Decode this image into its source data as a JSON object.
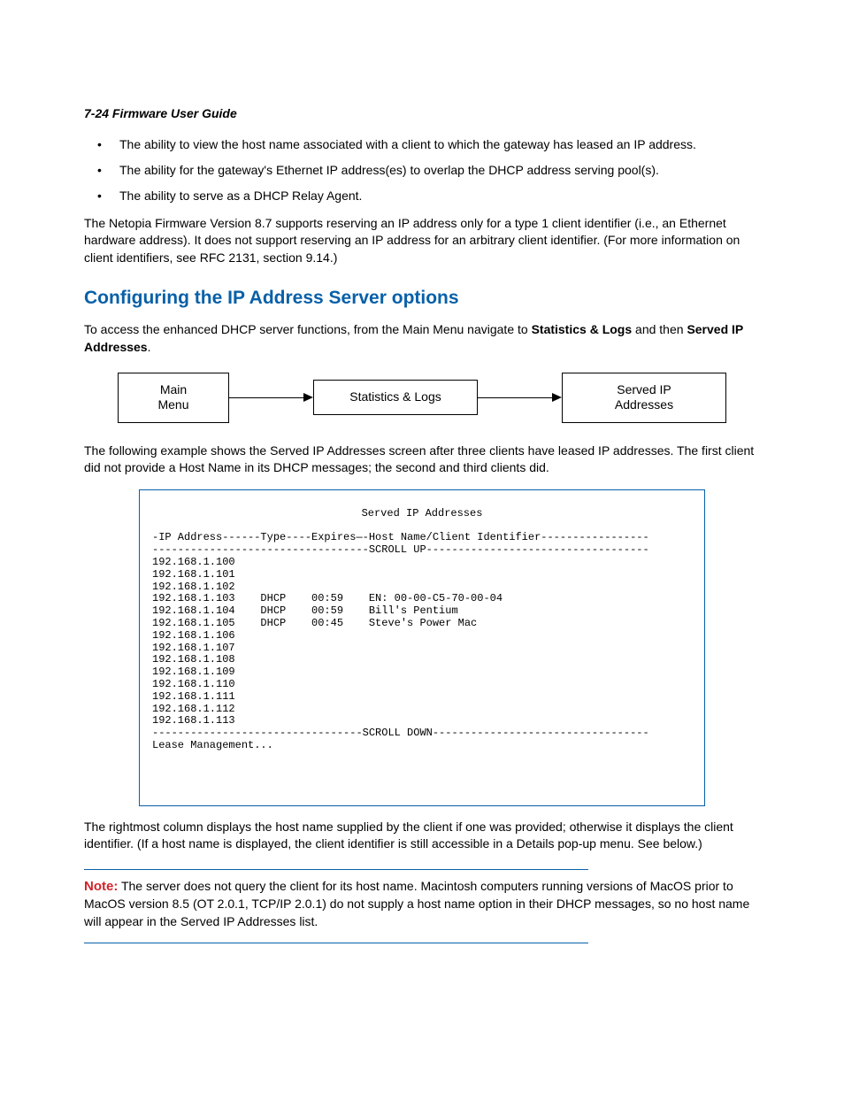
{
  "header": "7-24  Firmware User Guide",
  "bullets": [
    "The ability to view the host name associated with a client to which the gateway has leased an IP address.",
    "The ability for the gateway's Ethernet IP address(es) to overlap the DHCP address serving pool(s).",
    "The ability to serve as a DHCP Relay Agent."
  ],
  "para1": "The Netopia Firmware Version 8.7 supports reserving an IP address only for a type 1 client identifier (i.e., an Ethernet hardware address). It does not support reserving an IP address for an arbitrary client identifier. (For more information on client identifiers, see RFC 2131, section 9.14.)",
  "section_title": "Configuring the IP Address Server options",
  "para2_a": "To access the enhanced DHCP server functions, from the Main Menu navigate to ",
  "para2_b": "Statistics & Logs",
  "para2_c": " and then ",
  "para2_d": "Served IP Addresses",
  "para2_e": ".",
  "nav": {
    "box1_l1": "Main",
    "box1_l2": "Menu",
    "box2": "Statistics & Logs",
    "box3_l1": "Served IP",
    "box3_l2": "Addresses"
  },
  "para3": "The following example shows the Served IP Addresses screen after three clients have leased IP addresses. The first client did not provide a Host Name in its DHCP messages; the second and third clients did.",
  "terminal": {
    "title": "Served IP Addresses",
    "header_row": "-IP Address------Type----Expires—-Host Name/Client Identifier-----------------",
    "scroll_up": "----------------------------------SCROLL UP-----------------------------------",
    "rows": [
      "192.168.1.100",
      "192.168.1.101",
      "192.168.1.102",
      "192.168.1.103    DHCP    00:59    EN: 00-00-C5-70-00-04",
      "192.168.1.104    DHCP    00:59    Bill's Pentium",
      "192.168.1.105    DHCP    00:45    Steve's Power Mac",
      "192.168.1.106",
      "192.168.1.107",
      "192.168.1.108",
      "192.168.1.109",
      "192.168.1.110",
      "192.168.1.111",
      "192.168.1.112",
      "192.168.1.113"
    ],
    "scroll_down": "---------------------------------SCROLL DOWN----------------------------------",
    "footer": "Lease Management..."
  },
  "para4": "The rightmost column displays the host name supplied by the client if one was provided; otherwise it displays the client identifier. (If a host name is displayed, the client identifier is still accessible in a Details pop-up menu. See below.)",
  "note_label": "Note:",
  "note_body": "  The server does not query the client for its host name. Macintosh computers running versions of MacOS prior to MacOS version 8.5 (OT 2.0.1, TCP/IP 2.0.1) do not supply a host name option in their DHCP messages, so no host name will appear in the Served IP Addresses list."
}
